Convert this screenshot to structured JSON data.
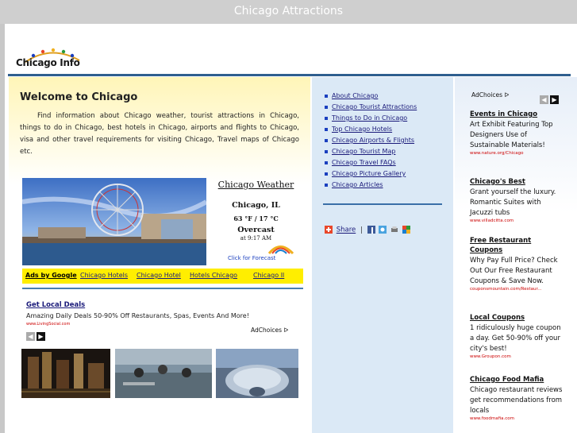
{
  "window": {
    "title": "Chicago Attractions"
  },
  "header": {
    "logo_text": "Chicago Info"
  },
  "welcome": {
    "title": "Welcome to Chicago",
    "intro": "Find information about Chicago weather, tourist attractions in Chicago, things to do in Chicago, best hotels in Chicago, airports and flights to Chicago, visa and other travel requirements for visiting Chicago, Travel maps of Chicago etc."
  },
  "weather": {
    "title": "Chicago Weather",
    "city": "Chicago, IL",
    "temp": "63 °F / 17 °C",
    "condition": "Overcast",
    "time": "at 9:17 AM",
    "forecast_link": "Click for Forecast"
  },
  "ad_links": {
    "ads_by": "Ads by Google",
    "links": [
      "Chicago Hotels",
      "Chicago Hotel",
      "Hotels Chicago",
      "Chicago Il"
    ]
  },
  "deal": {
    "title": "Get Local Deals",
    "text": "Amazing Daily Deals 50-90% Off Restaurants, Spas, Events And More!",
    "url": "www.LivingSocial.com",
    "adchoices": "AdChoices"
  },
  "nav": {
    "items": [
      "About Chicago",
      "Chicago Tourist Attractions",
      "Things to Do in Chicago",
      "Top Chicago Hotels",
      "Chicago Airports & Flights",
      "Chicago Tourist Map",
      "Chicago Travel FAQs",
      "Chicago Picture Gallery",
      "Chicago Articles"
    ],
    "share_label": "Share",
    "share_sep": "|"
  },
  "right_ads": {
    "adchoices": "AdChoices",
    "items": [
      {
        "title": "Events in Chicago",
        "text": "Art Exhibit Featuring Top Designers Use of Sustainable Materials!",
        "url": "www.nature.org/Chicago"
      },
      {
        "title": "Chicago's Best",
        "text": "Grant yourself the luxury. Romantic Suites with Jacuzzi tubs",
        "url": "www.villadcitta.com"
      },
      {
        "title": "Free Restaurant Coupons",
        "text": "Why Pay Full Price? Check Out Our Free Restaurant Coupons & Save Now.",
        "url": "couponsmountain.com/Restaur..."
      },
      {
        "title": "Local Coupons",
        "text": "1 ridiculously huge coupon a day. Get 50-90% off your city's best!",
        "url": "www.Groupon.com"
      },
      {
        "title": "Chicago Food Mafia",
        "text": "Chicago restaurant reviews get recommendations from locals",
        "url": "www.foodmafia.com"
      }
    ]
  },
  "icons": {
    "arrow_left": "◀",
    "arrow_right": "▶",
    "adchoices_icon": "ᐅ"
  },
  "colors": {
    "header_rule": "#2f5f8f",
    "link_blue": "#1a1a7a",
    "ad_yellow": "#ffee00",
    "nav_bg": "#dbe9f6"
  }
}
